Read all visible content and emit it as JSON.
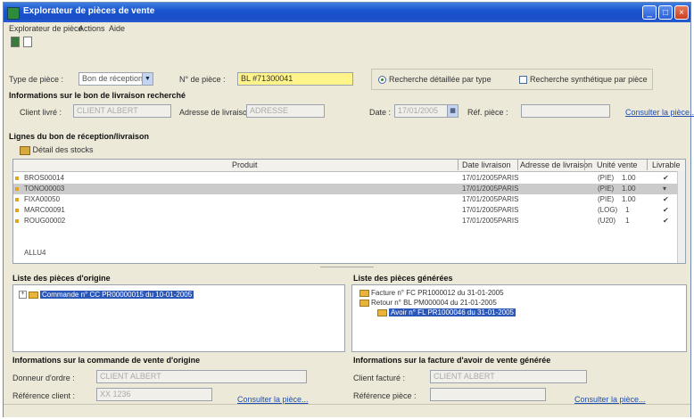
{
  "window": {
    "title": "Explorateur de pièces de vente",
    "min": "_",
    "max": "□",
    "close": "×"
  },
  "menu": [
    "Explorateur de pièce",
    "Actions",
    "Aide"
  ],
  "filters": {
    "type_label": "Type de pièce :",
    "type_value": "Bon de réception/li",
    "num_label": "N° de pièce :",
    "num_value": "BL #71300041",
    "radio_detailed": "Recherche détaillée par type",
    "check_synthetic": "Recherche synthétique par pièce"
  },
  "delivery_info": {
    "heading": "Informations sur le bon de livraison recherché",
    "client_label": "Client livré :",
    "client_value": "CLIENT ALBERT",
    "address_label": "Adresse de livraison :",
    "address_value": "ADRESSE",
    "date_label": "Date :",
    "date_value": "17/01/2005",
    "ref_label": "Réf. pièce :",
    "ref_value": "",
    "link": "Consulter la pièce..."
  },
  "lines": {
    "heading": "Lignes du bon de réception/livraison",
    "detail_button": "Détail des stocks",
    "columns": [
      "Produit",
      "Date livraison",
      "Adresse de livraison",
      "Unité vente",
      "Livrable"
    ],
    "rows": [
      {
        "product": "BROS00014",
        "date": "17/01/2005",
        "address": "PARIS",
        "unit": "(PIE)",
        "qty": "1.00",
        "check": "✔"
      },
      {
        "product": "TONO00003",
        "date": "17/01/2005",
        "address": "PARIS",
        "unit": "(PIE)",
        "qty": "1.00",
        "check": "▾"
      },
      {
        "product": "FIXA00050",
        "date": "17/01/2005",
        "address": "PARIS",
        "unit": "(PIE)",
        "qty": "1.00",
        "check": "✔"
      },
      {
        "product": "MARC00091",
        "date": "17/01/2005",
        "address": "PARIS",
        "unit": "(LOG)",
        "qty": "1",
        "check": "✔"
      },
      {
        "product": "ROUG00002",
        "date": "17/01/2005",
        "address": "PARIS",
        "unit": "(U20)",
        "qty": "1",
        "check": "✔"
      }
    ],
    "footer": "ALLU4"
  },
  "origin": {
    "heading": "Liste des pièces d'origine",
    "node": "Commande n° CC PR00000015 du 10-01-2005",
    "info_heading": "Informations sur la commande de vente d'origine",
    "orderer_label": "Donneur d'ordre :",
    "orderer_value": "CLIENT ALBERT",
    "ref_label": "Référence client :",
    "ref_value": "XX 1236",
    "link": "Consulter la pièce..."
  },
  "generated": {
    "heading": "Liste des pièces générées",
    "nodes": [
      "Facture n° FC PR1000012 du 31-01-2005",
      "Retour n° BL PM000004 du 21-01-2005",
      "Avoir n° FL PR1000046 du 31-01-2005"
    ],
    "info_heading": "Informations sur la facture d'avoir de vente générée",
    "client_label": "Client facturé :",
    "client_value": "CLIENT ALBERT",
    "ref_label": "Référence pièce :",
    "ref_value": "",
    "link": "Consulter la pièce..."
  }
}
